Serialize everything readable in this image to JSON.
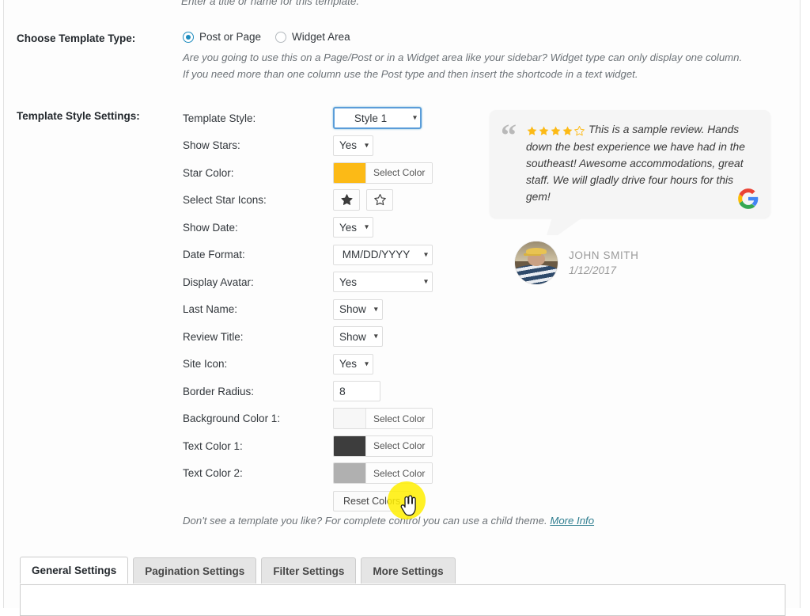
{
  "top_cut_text": "Enter a title or name for this template.",
  "sections": {
    "template_type_label": "Choose Template Type:",
    "style_settings_label": "Template Style Settings:"
  },
  "template_type": {
    "options": [
      {
        "label": "Post or Page",
        "selected": true
      },
      {
        "label": "Widget Area",
        "selected": false
      }
    ],
    "description_line1": "Are you going to use this on a Page/Post or in a Widget area like your sidebar? Widget type can only display one column.",
    "description_line2": "If you need more than one column use the Post type and then insert the shortcode in a text widget."
  },
  "style_settings": {
    "rows": [
      {
        "label": "Template Style:",
        "type": "select",
        "value": "Style 1",
        "focused": true
      },
      {
        "label": "Show Stars:",
        "type": "select",
        "value": "Yes"
      },
      {
        "label": "Star Color:",
        "type": "color",
        "value": "#fcba16",
        "button_label": "Select Color"
      },
      {
        "label": "Select Star Icons:",
        "type": "star-icons",
        "icons": [
          "star-filled-icon",
          "star-outline-icon"
        ]
      },
      {
        "label": "Show Date:",
        "type": "select",
        "value": "Yes"
      },
      {
        "label": "Date Format:",
        "type": "select",
        "value": "MM/DD/YYYY"
      },
      {
        "label": "Display Avatar:",
        "type": "select",
        "value": "Yes"
      },
      {
        "label": "Last Name:",
        "type": "select",
        "value": "Show"
      },
      {
        "label": "Review Title:",
        "type": "select",
        "value": "Show"
      },
      {
        "label": "Site Icon:",
        "type": "select",
        "value": "Yes"
      },
      {
        "label": "Border Radius:",
        "type": "number",
        "value": "8"
      },
      {
        "label": "Background Color 1:",
        "type": "color",
        "value": "#f7f7f7",
        "button_label": "Select Color"
      },
      {
        "label": "Text Color 1:",
        "type": "color",
        "value": "#3d3d3d",
        "button_label": "Select Color"
      },
      {
        "label": "Text Color 2:",
        "type": "color",
        "value": "#b0b0b0",
        "button_label": "Select Color"
      }
    ],
    "reset_button_label": "Reset Colors"
  },
  "footnote": {
    "text": "Don't see a template you like? For complete control you can use a child theme. ",
    "link_label": "More Info",
    "link_color": "#2e7d8f"
  },
  "review_preview": {
    "rating": 4,
    "max_rating": 5,
    "star_color": "#fcba16",
    "quote_glyph": "“",
    "text": "This is a sample review. Hands down the best experience we have had in the southeast! Awesome accommodations, great staff. We will gladly drive four hours for this gem!",
    "source_icon": "google-g-icon",
    "reviewer_name": "JOHN SMITH",
    "review_date": "1/12/2017",
    "avatar_icon": "user-avatar-photo"
  },
  "bottom_tabs": [
    {
      "label": "General Settings",
      "active": true
    },
    {
      "label": "Pagination Settings",
      "active": false
    },
    {
      "label": "Filter Settings",
      "active": false
    },
    {
      "label": "More Settings",
      "active": false
    }
  ],
  "cursor": {
    "icon": "pointing-hand-cursor",
    "highlight_color": "#ffee00"
  }
}
